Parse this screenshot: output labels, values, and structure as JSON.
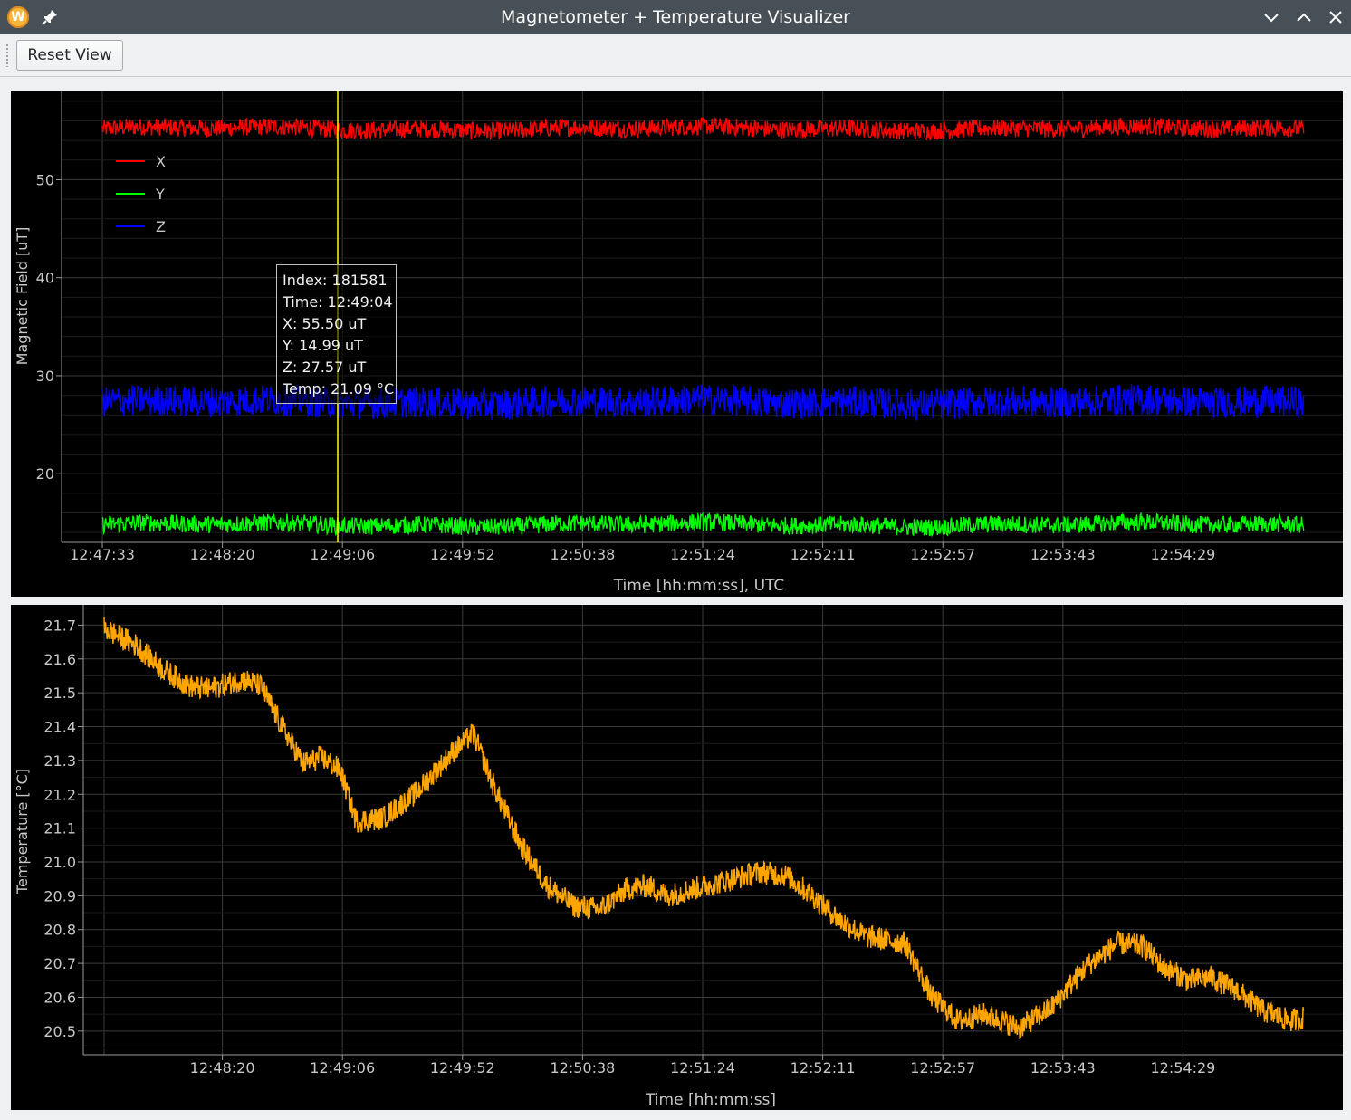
{
  "window": {
    "title": "Magnetometer + Temperature Visualizer"
  },
  "toolbar": {
    "reset_label": "Reset View"
  },
  "colors": {
    "x": "#ff0000",
    "y": "#00ff00",
    "z": "#0000ff",
    "temp": "#ffa500",
    "cursor": "#ffff00",
    "axis_text": "#c8c8c8",
    "grid": "#3a3a3a"
  },
  "tooltip": {
    "index": "Index: 181581",
    "time": "Time: 12:49:04",
    "x": "X: 55.50 uT",
    "y": "Y: 14.99 uT",
    "z": "Z: 27.57 uT",
    "temp": "Temp: 21.09 °C"
  },
  "chart_data": [
    {
      "type": "line",
      "ylabel": "Magnetic Field [uT]",
      "xlabel": "Time [hh:mm:ss], UTC",
      "x_ticks": [
        "12:47:33",
        "12:48:20",
        "12:49:06",
        "12:49:52",
        "12:50:38",
        "12:51:24",
        "12:52:11",
        "12:52:57",
        "12:53:43",
        "12:54:29"
      ],
      "y_ticks": [
        20,
        30,
        40,
        50
      ],
      "ylim": [
        13,
        59
      ],
      "grid": true,
      "legend_position": "top-left",
      "cursor_time": "12:49:04",
      "series": [
        {
          "name": "X",
          "color": "#ff0000",
          "mean": 55.2,
          "noise": 0.9
        },
        {
          "name": "Y",
          "color": "#00ff00",
          "mean": 14.8,
          "noise": 0.9
        },
        {
          "name": "Z",
          "color": "#0000ff",
          "mean": 27.3,
          "noise": 1.6
        }
      ]
    },
    {
      "type": "line",
      "ylabel": "Temperature [°C]",
      "xlabel": "Time [hh:mm:ss]",
      "x_ticks": [
        "12:48:20",
        "12:49:06",
        "12:49:52",
        "12:50:38",
        "12:51:24",
        "12:52:11",
        "12:52:57",
        "12:53:43",
        "12:54:29"
      ],
      "y_ticks": [
        20.5,
        20.6,
        20.7,
        20.8,
        20.9,
        21.0,
        21.1,
        21.2,
        21.3,
        21.4,
        21.5,
        21.6,
        21.7
      ],
      "ylim": [
        20.43,
        21.76
      ],
      "grid": true,
      "series": [
        {
          "name": "",
          "color": "#ffa500",
          "points": [
            [
              "12:47:33",
              21.69
            ],
            [
              "12:47:45",
              21.64
            ],
            [
              "12:47:55",
              21.57
            ],
            [
              "12:48:05",
              21.52
            ],
            [
              "12:48:12",
              21.51
            ],
            [
              "12:48:25",
              21.54
            ],
            [
              "12:48:32",
              21.52
            ],
            [
              "12:48:40",
              21.4
            ],
            [
              "12:48:48",
              21.29
            ],
            [
              "12:48:55",
              21.31
            ],
            [
              "12:49:02",
              21.27
            ],
            [
              "12:49:08",
              21.12
            ],
            [
              "12:49:18",
              21.13
            ],
            [
              "12:49:30",
              21.2
            ],
            [
              "12:49:45",
              21.33
            ],
            [
              "12:49:52",
              21.38
            ],
            [
              "12:50:00",
              21.22
            ],
            [
              "12:50:10",
              21.05
            ],
            [
              "12:50:20",
              20.93
            ],
            [
              "12:50:30",
              20.87
            ],
            [
              "12:50:40",
              20.86
            ],
            [
              "12:50:50",
              20.92
            ],
            [
              "12:50:58",
              20.93
            ],
            [
              "12:51:05",
              20.9
            ],
            [
              "12:51:15",
              20.92
            ],
            [
              "12:51:30",
              20.95
            ],
            [
              "12:51:40",
              20.97
            ],
            [
              "12:51:50",
              20.96
            ],
            [
              "12:52:00",
              20.9
            ],
            [
              "12:52:10",
              20.83
            ],
            [
              "12:52:20",
              20.78
            ],
            [
              "12:52:35",
              20.76
            ],
            [
              "12:52:45",
              20.6
            ],
            [
              "12:52:55",
              20.53
            ],
            [
              "12:53:05",
              20.55
            ],
            [
              "12:53:18",
              20.51
            ],
            [
              "12:53:30",
              20.57
            ],
            [
              "12:53:43",
              20.69
            ],
            [
              "12:53:55",
              20.76
            ],
            [
              "12:54:05",
              20.75
            ],
            [
              "12:54:12",
              20.69
            ],
            [
              "12:54:22",
              20.65
            ],
            [
              "12:54:30",
              20.66
            ],
            [
              "12:54:40",
              20.62
            ],
            [
              "12:54:50",
              20.56
            ],
            [
              "12:55:00",
              20.53
            ],
            [
              "12:55:05",
              20.54
            ]
          ]
        }
      ]
    }
  ]
}
